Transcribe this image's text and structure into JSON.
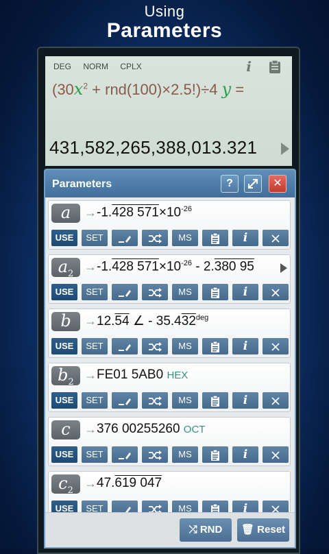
{
  "headline": {
    "line1": "Using",
    "line2": "Parameters"
  },
  "screen": {
    "modes": [
      "DEG",
      "NORM",
      "CPLX"
    ],
    "expression": {
      "p1": "(30",
      "x": "x",
      "exp": "2",
      "p2": "+ rnd(100)×2.5!)÷4",
      "y": "y",
      "p3": "="
    },
    "result": "431,582,265,388,013.321",
    "info_icon": "info-icon",
    "clipboard_icon": "clipboard-icon"
  },
  "dialog": {
    "title": "Parameters",
    "help": "?",
    "close": "✕",
    "buttons": {
      "use": "USE",
      "set": "SET",
      "ms": "MS"
    },
    "params": [
      {
        "name": "a",
        "sub": "",
        "v1": "-1.",
        "v2": "428 571",
        "v3": "×10",
        "sup": "-26",
        "v4": "",
        "v5": "",
        "tag": ""
      },
      {
        "name": "a",
        "sub": "2",
        "v1": "-1.",
        "v2": "428 571",
        "v3": "×10",
        "sup": "-26",
        "v4": " - 2.",
        "v5": "380 95",
        "tag": ""
      },
      {
        "name": "b",
        "sub": "",
        "v1": "12.",
        "v2": "54",
        "v3": " ∠ - 35.4",
        "sup": "",
        "v4": "",
        "v5": "32",
        "tag": "deg"
      },
      {
        "name": "b",
        "sub": "2",
        "v1": "FE01 5AB0",
        "v2": "",
        "v3": "",
        "sup": "",
        "v4": "",
        "v5": "",
        "tag": "HEX"
      },
      {
        "name": "c",
        "sub": "",
        "v1": "376 00255260",
        "v2": "",
        "v3": "",
        "sup": "",
        "v4": "",
        "v5": "",
        "tag": "OCT"
      },
      {
        "name": "c",
        "sub": "2",
        "v1": "47.",
        "v2": "619 047",
        "v3": "",
        "sup": "",
        "v4": "",
        "v5": "",
        "tag": ""
      }
    ],
    "footer": {
      "rnd": "RND",
      "reset": "Reset"
    }
  },
  "colors": {
    "accent": "#3f6f9a",
    "variable": "#2ba048",
    "close": "#c23a30"
  }
}
